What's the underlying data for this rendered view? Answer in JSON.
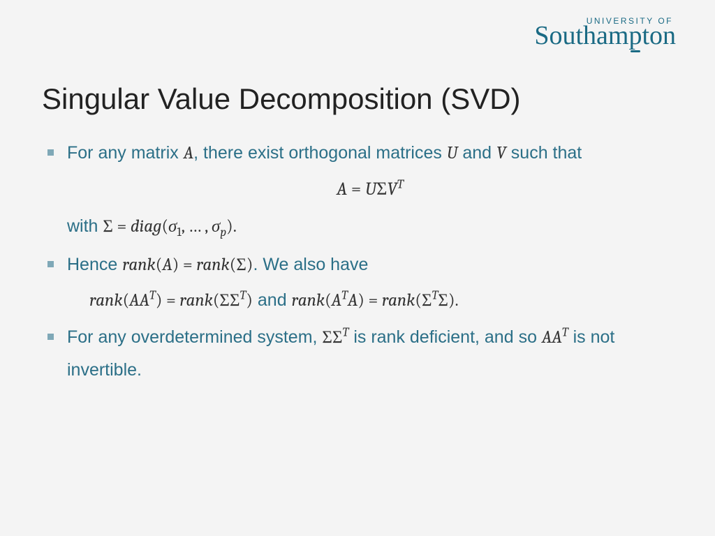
{
  "logo": {
    "line1": "UNIVERSITY OF",
    "line2_a": "Southam",
    "line2_b": "p",
    "line2_c": "ton"
  },
  "title": "Singular Value Decomposition (SVD)",
  "b1": {
    "t1": "For any matrix ",
    "mA": "A",
    "t2": ", there exist orthogonal matrices ",
    "mU": "U",
    "t3": " and ",
    "mV": "V",
    "t4": " such that"
  },
  "eq1": {
    "A": "A",
    "eq": " = ",
    "U": "U",
    "Sigma": "Σ",
    "V": "V",
    "T": "T"
  },
  "withline": {
    "with": "with ",
    "sigma": "Σ",
    "eq": " = ",
    "diag": "diag",
    "lp": "(",
    "s1": "σ",
    "sub1": "1",
    "comma": ", … , ",
    "sp": "σ",
    "subp": "p",
    "rp": ").",
    "period": ""
  },
  "b2": {
    "t1": "Hence ",
    "r1": "rank",
    "lp1": "(",
    "A1": "A",
    "rp1": ")",
    "eq": " = ",
    "r2": "rank",
    "lp2": "(",
    "S1": "Σ",
    "rp2": ")",
    "t2": ". We also have"
  },
  "rankline": {
    "r3": "rank",
    "lp3": "(",
    "AA": "AA",
    "T1": "T",
    "rp3": ")",
    "eq1": " = ",
    "r4": "rank",
    "lp4": "(",
    "SS": "ΣΣ",
    "T2": "T",
    "rp4": ")",
    "and": " and ",
    "r5": "rank",
    "lp5": "(",
    "A2": "A",
    "T3": "T",
    "A3": "A",
    "rp5": ")",
    "eq2": " = ",
    "r6": "rank",
    "lp6": "(",
    "S2": "Σ",
    "T4": "T",
    "S3": "Σ",
    "rp6": ")",
    "dot": "."
  },
  "b3": {
    "t1": "For any overdetermined system, ",
    "SS": "ΣΣ",
    "T1": "T",
    "t2": " is rank deficient, and so ",
    "AA": "AA",
    "T2": "T",
    "t3": " is not invertible."
  }
}
